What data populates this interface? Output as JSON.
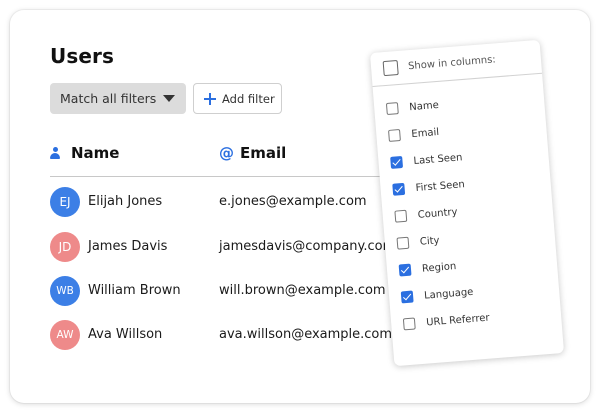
{
  "page": {
    "title": "Users"
  },
  "toolbar": {
    "match_label": "Match all filters",
    "add_filter_label": "Add filter"
  },
  "columns": {
    "name_label": "Name",
    "email_label": "Email",
    "email_icon_glyph": "@"
  },
  "users": [
    {
      "initials": "EJ",
      "name": "Elijah Jones",
      "email": "e.jones@example.com",
      "avatar_color": "#3c7fe6"
    },
    {
      "initials": "JD",
      "name": "James Davis",
      "email": "jamesdavis@company.com",
      "avatar_color": "#ee8a8a"
    },
    {
      "initials": "WB",
      "name": "William Brown",
      "email": "will.brown@example.com",
      "avatar_color": "#3c7fe6"
    },
    {
      "initials": "AW",
      "name": "Ava Willson",
      "email": "ava.willson@example.com",
      "avatar_color": "#ee8a8a"
    }
  ],
  "column_picker": {
    "header_label": "Show in columns:",
    "options": [
      {
        "label": "Name",
        "checked": false
      },
      {
        "label": "Email",
        "checked": false
      },
      {
        "label": "Last Seen",
        "checked": true
      },
      {
        "label": "First Seen",
        "checked": true
      },
      {
        "label": "Country",
        "checked": false
      },
      {
        "label": "City",
        "checked": false
      },
      {
        "label": "Region",
        "checked": true
      },
      {
        "label": "Language",
        "checked": true
      },
      {
        "label": "URL Referrer",
        "checked": false
      }
    ]
  },
  "colors": {
    "accent": "#2b6fe0",
    "blue_avatar": "#3c7fe6",
    "pink_avatar": "#ee8a8a",
    "match_button_bg": "#dcdcdc"
  },
  "icons": {
    "name_column": "person-icon",
    "email_column": "at-icon",
    "add_filter": "plus-icon",
    "match_dropdown": "caret-down-icon"
  }
}
